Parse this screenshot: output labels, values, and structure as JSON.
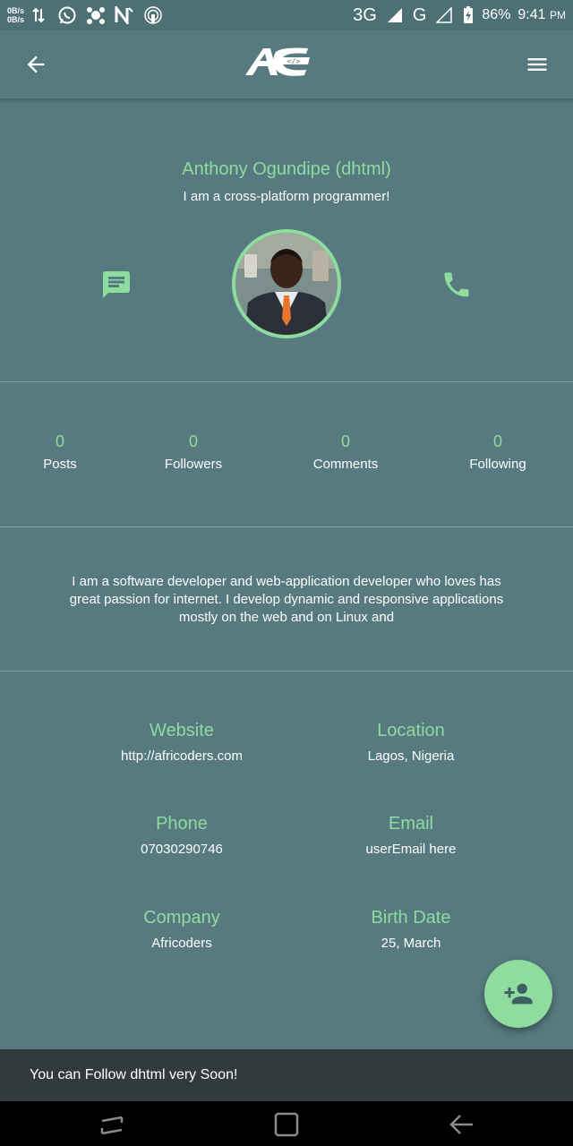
{
  "status_bar": {
    "net_up": "0B/s",
    "net_down": "0B/s",
    "network_1": "3G",
    "network_2": "G",
    "battery": "86%",
    "time": "9:41",
    "ampm": "PM"
  },
  "toolbar": {
    "back_icon": "arrow-back-icon",
    "menu_icon": "hamburger-menu-icon",
    "logo_text": "</>"
  },
  "profile": {
    "name": "Anthony Ogundipe (dhtml)",
    "tagline": "I am a cross-platform programmer!",
    "message_icon": "message-icon",
    "phone_icon": "phone-icon"
  },
  "stats": [
    {
      "value": "0",
      "label": "Posts"
    },
    {
      "value": "0",
      "label": "Followers"
    },
    {
      "value": "0",
      "label": "Comments"
    },
    {
      "value": "0",
      "label": "Following"
    }
  ],
  "bio": "I am a software developer and web-application developer who loves has great passion for internet. I develop dynamic and responsive applications mostly on the web and on Linux and",
  "info": {
    "website": {
      "title": "Website",
      "value": "http://africoders.com"
    },
    "location": {
      "title": "Location",
      "value": "Lagos, Nigeria"
    },
    "phone": {
      "title": "Phone",
      "value": "07030290746"
    },
    "email": {
      "title": "Email",
      "value": "userEmail here"
    },
    "company": {
      "title": "Company",
      "value": "Africoders"
    },
    "birthdate": {
      "title": "Birth Date",
      "value": "25, March"
    }
  },
  "fab_icon": "person-add-icon",
  "snackbar": "You can Follow dhtml very Soon!",
  "colors": {
    "background": "#567a7f",
    "accent": "#8fdc9f",
    "snackbar": "#323a3b"
  }
}
